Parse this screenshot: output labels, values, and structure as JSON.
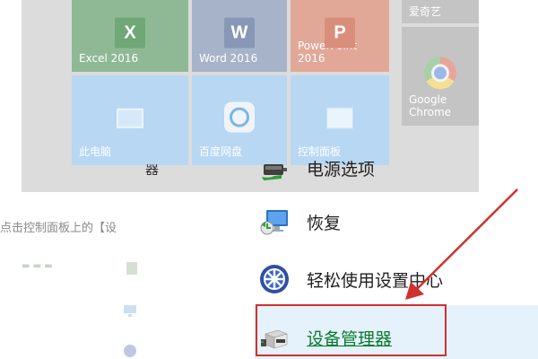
{
  "start_tiles": {
    "excel": {
      "label": "Excel 2016",
      "icon": "excel-icon"
    },
    "word": {
      "label": "Word 2016",
      "icon": "word-icon"
    },
    "powerpoint": {
      "label": "PowerPoint 2016",
      "icon": "powerpoint-icon"
    },
    "iqiyi": {
      "label": "爱奇艺"
    },
    "chrome": {
      "label": "Google Chrome",
      "icon": "chrome-icon"
    },
    "this_pc": {
      "label": "此电脑",
      "icon": "computer-icon"
    },
    "baidu": {
      "label": "百度网盘",
      "icon": "baidu-cloud-icon"
    },
    "control_panel": {
      "label": "控制面板",
      "icon": "control-panel-icon"
    }
  },
  "background": {
    "hint_text": "点击控制面板上的【设"
  },
  "control_panel_list": {
    "partial_item": "器",
    "items": [
      {
        "label": "电源选项",
        "icon": "power-options-icon"
      },
      {
        "label": "恢复",
        "icon": "recovery-icon"
      },
      {
        "label": "轻松使用设置中心",
        "icon": "ease-of-access-icon"
      },
      {
        "label": "设备管理器",
        "icon": "device-manager-icon",
        "selected": true
      }
    ]
  },
  "annotation": {
    "color": "#d0312d"
  }
}
